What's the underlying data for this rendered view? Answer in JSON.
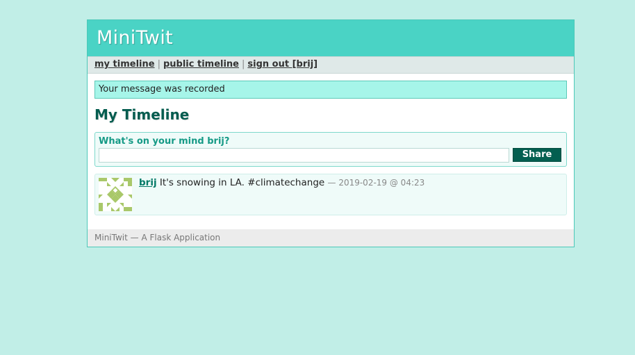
{
  "app": {
    "title": "MiniTwit"
  },
  "navigation": {
    "my_timeline": "my timeline",
    "public_timeline": "public timeline",
    "sign_out": "sign out [brij]",
    "separator": "|"
  },
  "flash": {
    "message": "Your message was recorded"
  },
  "main": {
    "heading": "My Timeline"
  },
  "twitbox": {
    "prompt": "What's on your mind brij?",
    "input_value": "",
    "share_label": "Share"
  },
  "messages": [
    {
      "user": "brij",
      "text": "It's snowing in LA. #climatechange",
      "date": "— 2019-02-19 @ 04:23",
      "avatar_icon": "identicon-avatar",
      "avatar_color": "#a9c86a"
    }
  ],
  "footer": {
    "text": "MiniTwit — A Flask Application"
  },
  "colors": {
    "background": "#c1eee7",
    "header": "#4ad3c5",
    "heading": "#045c4f",
    "share_button": "#035f50"
  }
}
